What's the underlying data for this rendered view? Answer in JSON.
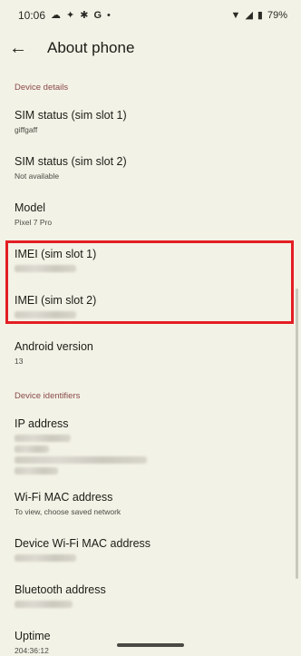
{
  "status_bar": {
    "time": "10:06",
    "battery": "79%"
  },
  "app_bar": {
    "title": "About phone",
    "back_icon": "arrow-back-icon"
  },
  "sections": {
    "device_details": "Device details",
    "device_identifiers": "Device identifiers"
  },
  "items": {
    "sim1": {
      "label": "SIM status (sim slot 1)",
      "value": "giffgaff"
    },
    "sim2": {
      "label": "SIM status (sim slot 2)",
      "value": "Not available"
    },
    "model": {
      "label": "Model",
      "value": "Pixel 7 Pro"
    },
    "imei1": {
      "label": "IMEI (sim slot 1)"
    },
    "imei2": {
      "label": "IMEI (sim slot 2)"
    },
    "android": {
      "label": "Android version",
      "value": "13"
    },
    "ip": {
      "label": "IP address"
    },
    "wifi_mac": {
      "label": "Wi-Fi MAC address",
      "value": "To view, choose saved network"
    },
    "device_wifi_mac": {
      "label": "Device Wi-Fi MAC address"
    },
    "bluetooth": {
      "label": "Bluetooth address"
    },
    "uptime": {
      "label": "Uptime",
      "value": "204:36:12"
    }
  },
  "colors": {
    "background": "#f3f2e6",
    "section_header": "#8a4a4a",
    "highlight_border": "#e31e24"
  }
}
